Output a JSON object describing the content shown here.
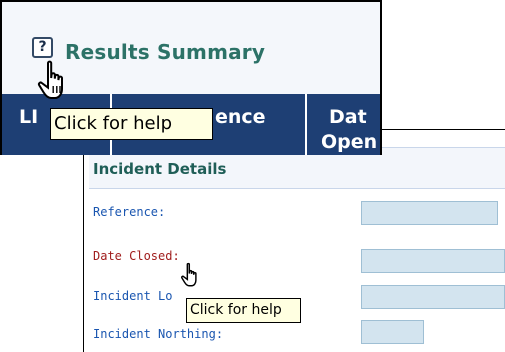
{
  "results_panel": {
    "help_icon_glyph": "?",
    "title": "Results Summary",
    "columns": [
      {
        "label_line1": "LI",
        "label_line2": ""
      },
      {
        "label_line1": "ence",
        "label_line2": ""
      },
      {
        "label_line1": "Dat",
        "label_line2": "Open"
      }
    ],
    "tooltip": "Click for help"
  },
  "details_panel": {
    "title": "Incident Details",
    "fields": [
      {
        "label": "Reference:"
      },
      {
        "label": "Date Closed:"
      },
      {
        "label": "Incident Lo"
      },
      {
        "label": "Incident Northing:"
      }
    ],
    "tooltip": "Click for help"
  },
  "colors": {
    "title_green": "#2c7267",
    "header_navy": "#1e3f74",
    "label_blue": "#1a56b0",
    "label_red": "#a01d1d",
    "input_fill": "#d3e4ef",
    "tooltip_bg": "#ffffe1"
  }
}
